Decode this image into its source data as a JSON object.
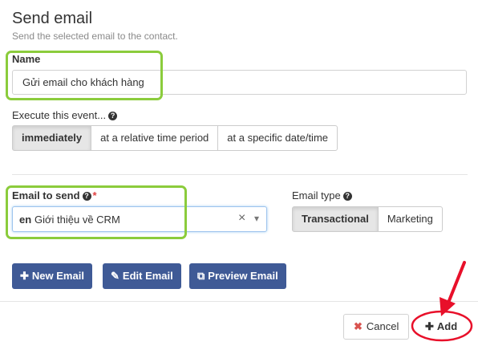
{
  "header": {
    "title": "Send email",
    "subtitle": "Send the selected email to the contact."
  },
  "name_field": {
    "label": "Name",
    "value": "Gửi email cho khách hàng"
  },
  "execute": {
    "label": "Execute this event...",
    "help_icon": "question-circle-icon",
    "options": [
      "immediately",
      "at a relative time period",
      "at a specific date/time"
    ],
    "selected": "immediately"
  },
  "email_to_send": {
    "label": "Email to send",
    "required_mark": "*",
    "help_icon": "question-circle-icon",
    "lang_badge": "en",
    "selected_value": "Giới thiệu về CRM",
    "clear_icon": "×",
    "caret_icon": "▾"
  },
  "email_type": {
    "label": "Email type",
    "help_icon": "question-circle-icon",
    "options": [
      "Transactional",
      "Marketing"
    ],
    "selected": "Transactional"
  },
  "actions": {
    "new_email": "New Email",
    "edit_email": "Edit Email",
    "preview_email": "Preview Email"
  },
  "footer": {
    "cancel_label": "Cancel",
    "add_label": "Add"
  },
  "colors": {
    "primary": "#3f5a96",
    "highlight_green": "#8bcc3c",
    "annotation_red": "#e8102a",
    "cancel_icon": "#d9534f"
  }
}
